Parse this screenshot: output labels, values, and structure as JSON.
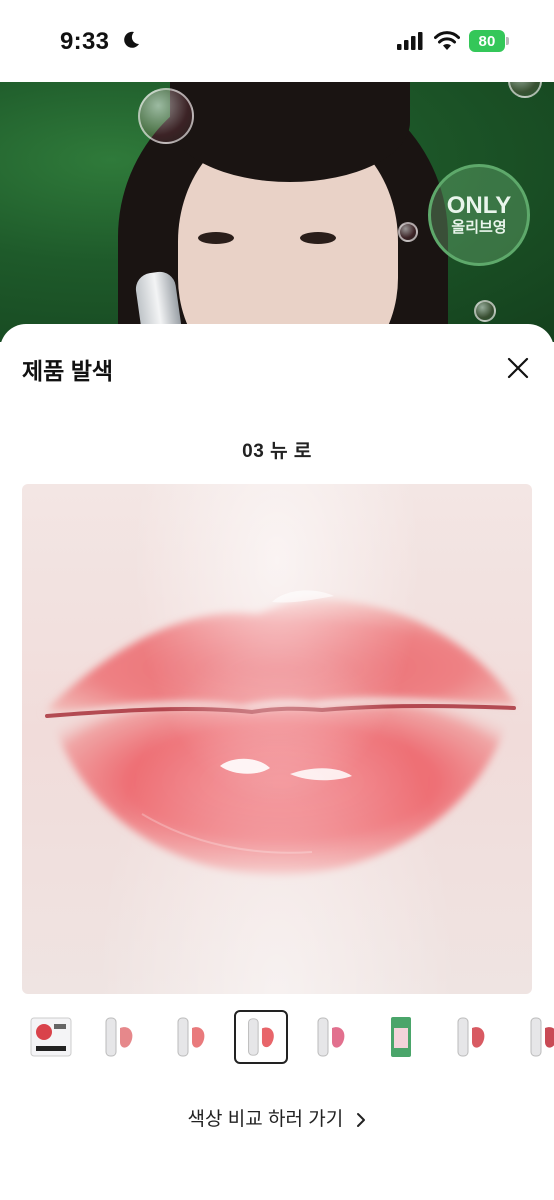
{
  "status_bar": {
    "time": "9:33",
    "battery": "80",
    "battery_color": "#34c759"
  },
  "background_banner": {
    "badge_top": "ONLY",
    "badge_bottom": "올리브영"
  },
  "sheet": {
    "title": "제품 발색",
    "close_icon": "close-icon",
    "shade_name": "03 뉴 로",
    "thumbnails": [
      {
        "kind": "package",
        "selected": false
      },
      {
        "kind": "tube",
        "selected": false
      },
      {
        "kind": "tube",
        "selected": false
      },
      {
        "kind": "tube",
        "selected": true
      },
      {
        "kind": "tube",
        "selected": false
      },
      {
        "kind": "box",
        "selected": false
      },
      {
        "kind": "tube",
        "selected": false
      },
      {
        "kind": "tube",
        "selected": false
      }
    ],
    "compare_link": "색상 비교 하러 가기",
    "accent_lip": "#e8656a"
  }
}
